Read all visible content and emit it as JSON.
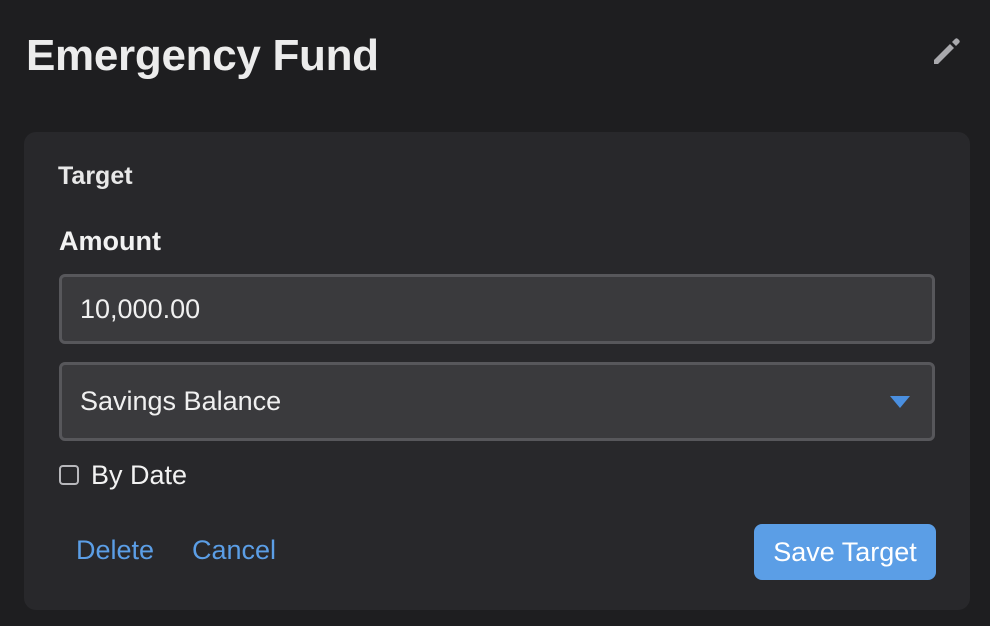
{
  "header": {
    "title": "Emergency Fund",
    "edit_icon": "pencil-icon"
  },
  "target_card": {
    "section_label": "Target",
    "amount_label": "Amount",
    "amount_value": "10,000.00",
    "type_select": {
      "selected": "Savings Balance",
      "icon": "caret-down-icon"
    },
    "by_date": {
      "label": "By Date",
      "checked": false
    },
    "actions": {
      "delete_label": "Delete",
      "cancel_label": "Cancel",
      "save_label": "Save Target"
    }
  },
  "colors": {
    "background": "#1e1e20",
    "card": "#28282b",
    "input": "#3a3a3d",
    "accent": "#5b9ee6",
    "caret": "#4a8fe0"
  }
}
